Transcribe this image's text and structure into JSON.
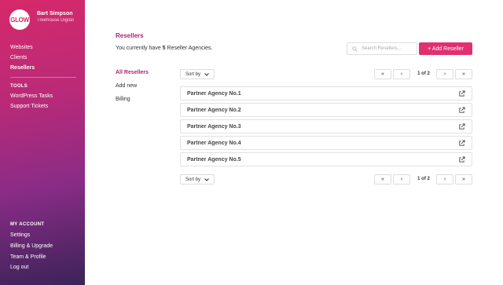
{
  "sidebar": {
    "logo_text": "GLOW",
    "user_name": "Bart Simpson",
    "user_org": "Treehouse Digital",
    "nav": [
      "Websites",
      "Clients",
      "Resellers"
    ],
    "tools_heading": "TOOLS",
    "tools": [
      "WordPress Tasks",
      "Support Tickets"
    ],
    "account_heading": "MY ACCOUNT",
    "account": [
      "Settings",
      "Billing & Upgrade",
      "Team & Profile",
      "Log out"
    ]
  },
  "main": {
    "title": "Resellers",
    "summary_prefix": "You currently have ",
    "summary_count": "5",
    "summary_suffix": " Reseller Agencies.",
    "search_placeholder": "Search Resellers...",
    "add_button": "+ Add Reseller",
    "subnav": [
      "All Resellers",
      "Add new",
      "Billing"
    ],
    "sort_label": "Sort by",
    "pagination": {
      "first": "«",
      "prev": "‹",
      "label": "1 of 2",
      "next": "›",
      "last": "»"
    },
    "agencies": [
      "Partner Agency No.1",
      "Partner Agency No.2",
      "Partner Agency No.3",
      "Partner Agency No.4",
      "Partner Agency No.5"
    ]
  },
  "colors": {
    "accent": "#e0306f",
    "title": "#a8256d"
  }
}
